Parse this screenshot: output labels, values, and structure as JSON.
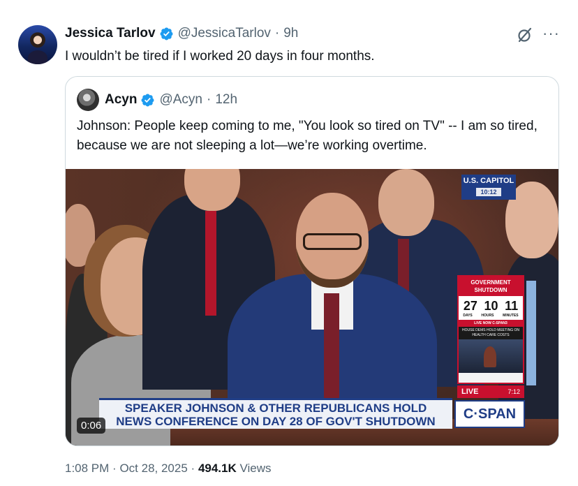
{
  "tweet": {
    "author_name": "Jessica Tarlov",
    "handle": "@JessicaTarlov",
    "separator": "·",
    "age": "9h",
    "text": "I wouldn’t be tired if I worked 20 days in four months.",
    "more_label": "···"
  },
  "quote": {
    "author_name": "Acyn",
    "handle": "@Acyn",
    "separator": "·",
    "age": "12h",
    "text": "Johnson: People keep coming to me, \"You look so tired on TV\" -- I am so tired, because we are not sleeping a lot—we’re working overtime."
  },
  "video": {
    "duration": "0:06",
    "overlay": {
      "capitol_label": "U.S. CAPITOL",
      "capitol_time": "10:12",
      "shutdown_title": "GOVERNMENT SHUTDOWN",
      "counter_days": "27",
      "counter_hours": "10",
      "counter_minutes": "11",
      "unit_days": "DAYS",
      "unit_hours": "HOURS",
      "unit_minutes": "MINUTES",
      "live_now": "LIVE NOW C-SPAN3",
      "sub_caption": "HOUSE DEMS HOLD MEETING ON HEALTH CARE COSTS",
      "live_label": "LIVE",
      "live_time": "7:12",
      "lower_third_line1": "SPEAKER JOHNSON & OTHER REPUBLICANS HOLD",
      "lower_third_line2": "NEWS CONFERENCE ON DAY 28 OF GOV'T SHUTDOWN",
      "network_logo": "C·SPAN"
    }
  },
  "meta": {
    "time": "1:08 PM",
    "dot1": "·",
    "date": "Oct 28, 2025",
    "dot2": "·",
    "views_count": "494.1K",
    "views_label": "Views"
  },
  "colors": {
    "verified": "#1d9bf0",
    "cspan_blue": "#1f3d86",
    "cspan_red": "#c8102e"
  },
  "icons": [
    "verified-badge-icon",
    "grok-icon",
    "more-options-icon"
  ]
}
